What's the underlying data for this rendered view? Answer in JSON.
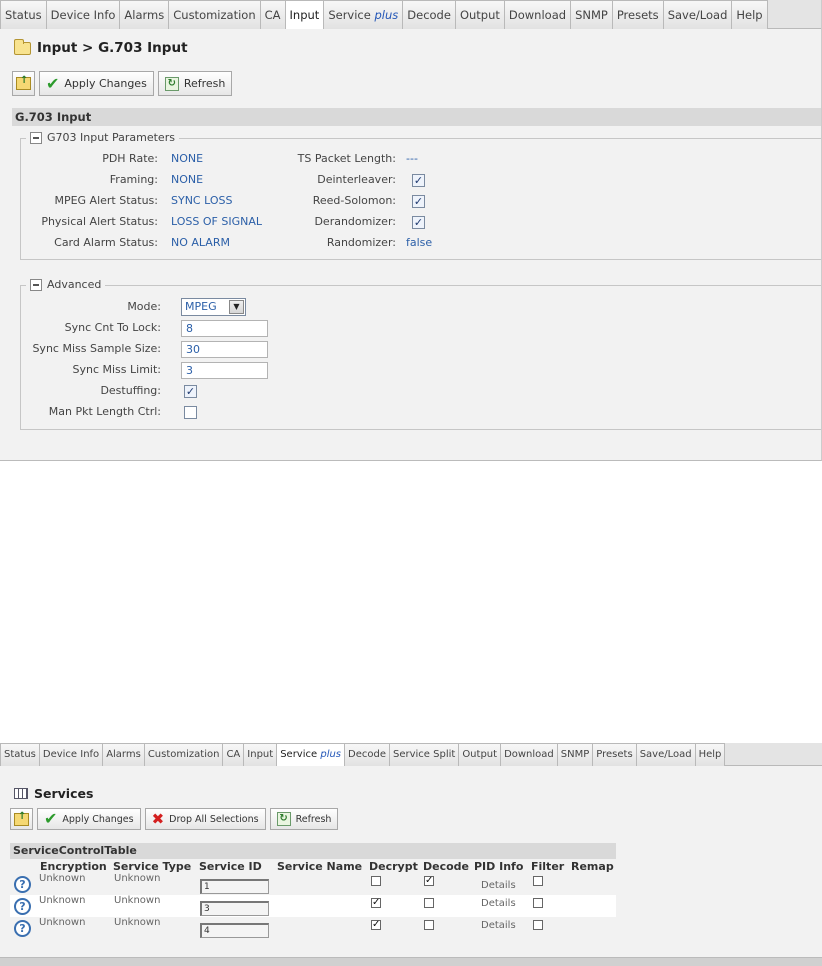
{
  "input_page": {
    "tabs": [
      {
        "label": "Status"
      },
      {
        "label": "Device Info"
      },
      {
        "label": "Alarms"
      },
      {
        "label": "Customization"
      },
      {
        "label": "CA"
      },
      {
        "label": "Input"
      },
      {
        "label": "Service",
        "suffix": "plus"
      },
      {
        "label": "Decode"
      },
      {
        "label": "Output"
      },
      {
        "label": "Download"
      },
      {
        "label": "SNMP"
      },
      {
        "label": "Presets"
      },
      {
        "label": "Save/Load"
      },
      {
        "label": "Help"
      }
    ],
    "active_tab": "Input",
    "breadcrumb": "Input > G.703 Input",
    "toolbar": {
      "apply_label": "Apply Changes",
      "refresh_label": "Refresh"
    },
    "section_title": "G.703 Input",
    "params": {
      "legend": "G703 Input Parameters",
      "pdh_rate_label": "PDH Rate:",
      "pdh_rate_value": "NONE",
      "framing_label": "Framing:",
      "framing_value": "NONE",
      "mpeg_alert_label": "MPEG Alert Status:",
      "mpeg_alert_value": "SYNC LOSS",
      "physical_alert_label": "Physical Alert Status:",
      "physical_alert_value": "LOSS OF SIGNAL",
      "card_alarm_label": "Card Alarm Status:",
      "card_alarm_value": "NO ALARM",
      "ts_packet_label": "TS Packet Length:",
      "ts_packet_value": "---",
      "deinterleaver_label": "Deinterleaver:",
      "deinterleaver_checked": true,
      "reed_solomon_label": "Reed-Solomon:",
      "reed_solomon_checked": true,
      "derandomizer_label": "Derandomizer:",
      "derandomizer_checked": true,
      "randomizer_label": "Randomizer:",
      "randomizer_value": "false"
    },
    "advanced": {
      "legend": "Advanced",
      "mode_label": "Mode:",
      "mode_value": "MPEG",
      "sync_cnt_label": "Sync Cnt To Lock:",
      "sync_cnt_value": "8",
      "sync_miss_sample_label": "Sync Miss Sample Size:",
      "sync_miss_sample_value": "30",
      "sync_miss_limit_label": "Sync Miss Limit:",
      "sync_miss_limit_value": "3",
      "destuffing_label": "Destuffing:",
      "destuffing_checked": true,
      "man_pkt_label": "Man Pkt Length Ctrl:",
      "man_pkt_checked": false
    }
  },
  "service_page": {
    "tabs": [
      {
        "label": "Status"
      },
      {
        "label": "Device Info"
      },
      {
        "label": "Alarms"
      },
      {
        "label": "Customization"
      },
      {
        "label": "CA"
      },
      {
        "label": "Input"
      },
      {
        "label": "Service",
        "suffix": "plus"
      },
      {
        "label": "Decode"
      },
      {
        "label": "Service Split"
      },
      {
        "label": "Output"
      },
      {
        "label": "Download"
      },
      {
        "label": "SNMP"
      },
      {
        "label": "Presets"
      },
      {
        "label": "Save/Load"
      },
      {
        "label": "Help"
      }
    ],
    "active_tab": "Service",
    "title": "Services",
    "toolbar": {
      "apply_label": "Apply Changes",
      "drop_label": "Drop All Selections",
      "refresh_label": "Refresh"
    },
    "table_title": "ServiceControlTable",
    "columns": [
      "Encryption",
      "Service Type",
      "Service ID",
      "Service Name",
      "Decrypt",
      "Decode",
      "PID Info",
      "Filter",
      "Remap"
    ],
    "rows": [
      {
        "encryption": "Unknown",
        "service_type": "Unknown",
        "service_id": "1",
        "service_name": "",
        "decrypt": false,
        "decode": true,
        "pid_info": "Details",
        "filter": false
      },
      {
        "encryption": "Unknown",
        "service_type": "Unknown",
        "service_id": "3",
        "service_name": "",
        "decrypt": true,
        "decode": false,
        "pid_info": "Details",
        "filter": false
      },
      {
        "encryption": "Unknown",
        "service_type": "Unknown",
        "service_id": "4",
        "service_name": "",
        "decrypt": true,
        "decode": false,
        "pid_info": "Details",
        "filter": false
      }
    ],
    "colors": {
      "link_blue": "#2b5fa8",
      "accent_green": "#2d9b2d",
      "drop_red": "#d42020"
    }
  }
}
